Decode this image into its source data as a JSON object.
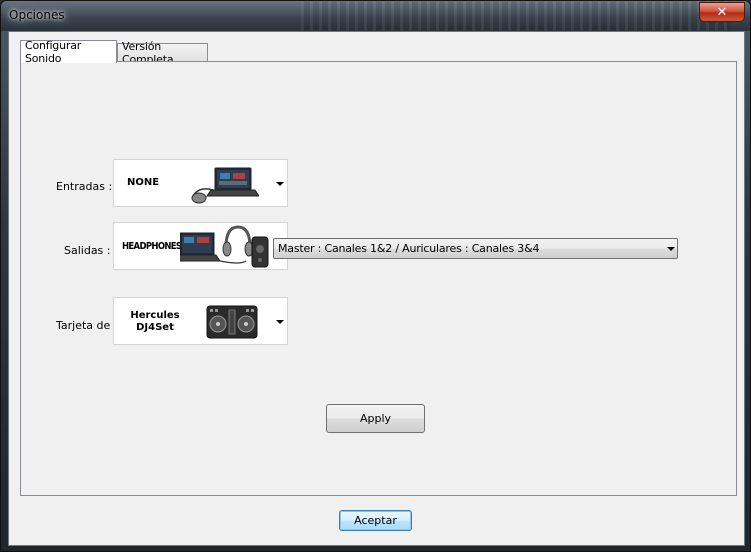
{
  "window": {
    "title": "Opciones",
    "close_label": "✕"
  },
  "tabs": [
    {
      "label": "Configurar Sonido",
      "active": true
    },
    {
      "label": "Versión Completa",
      "active": false
    }
  ],
  "sound": {
    "inputs": {
      "label": "Entradas :",
      "device": "NONE",
      "icon": "laptop-with-mouse-icon"
    },
    "outputs": {
      "label": "Salidas :",
      "device": "HEADPHONES",
      "icon": "laptop-headphones-speaker-icon",
      "routing_value": "Master : Canales 1&2 / Auriculares : Canales 3&4"
    },
    "card": {
      "label": "Tarjeta de",
      "device_line1": "Hercules",
      "device_line2": "DJ4Set",
      "icon": "dj-controller-icon"
    }
  },
  "buttons": {
    "apply": "Apply",
    "accept": "Aceptar"
  },
  "colors": {
    "client_bg": "#f0f0f0",
    "close_red": "#c7432a",
    "default_button_blue": "#3c7fb1"
  }
}
